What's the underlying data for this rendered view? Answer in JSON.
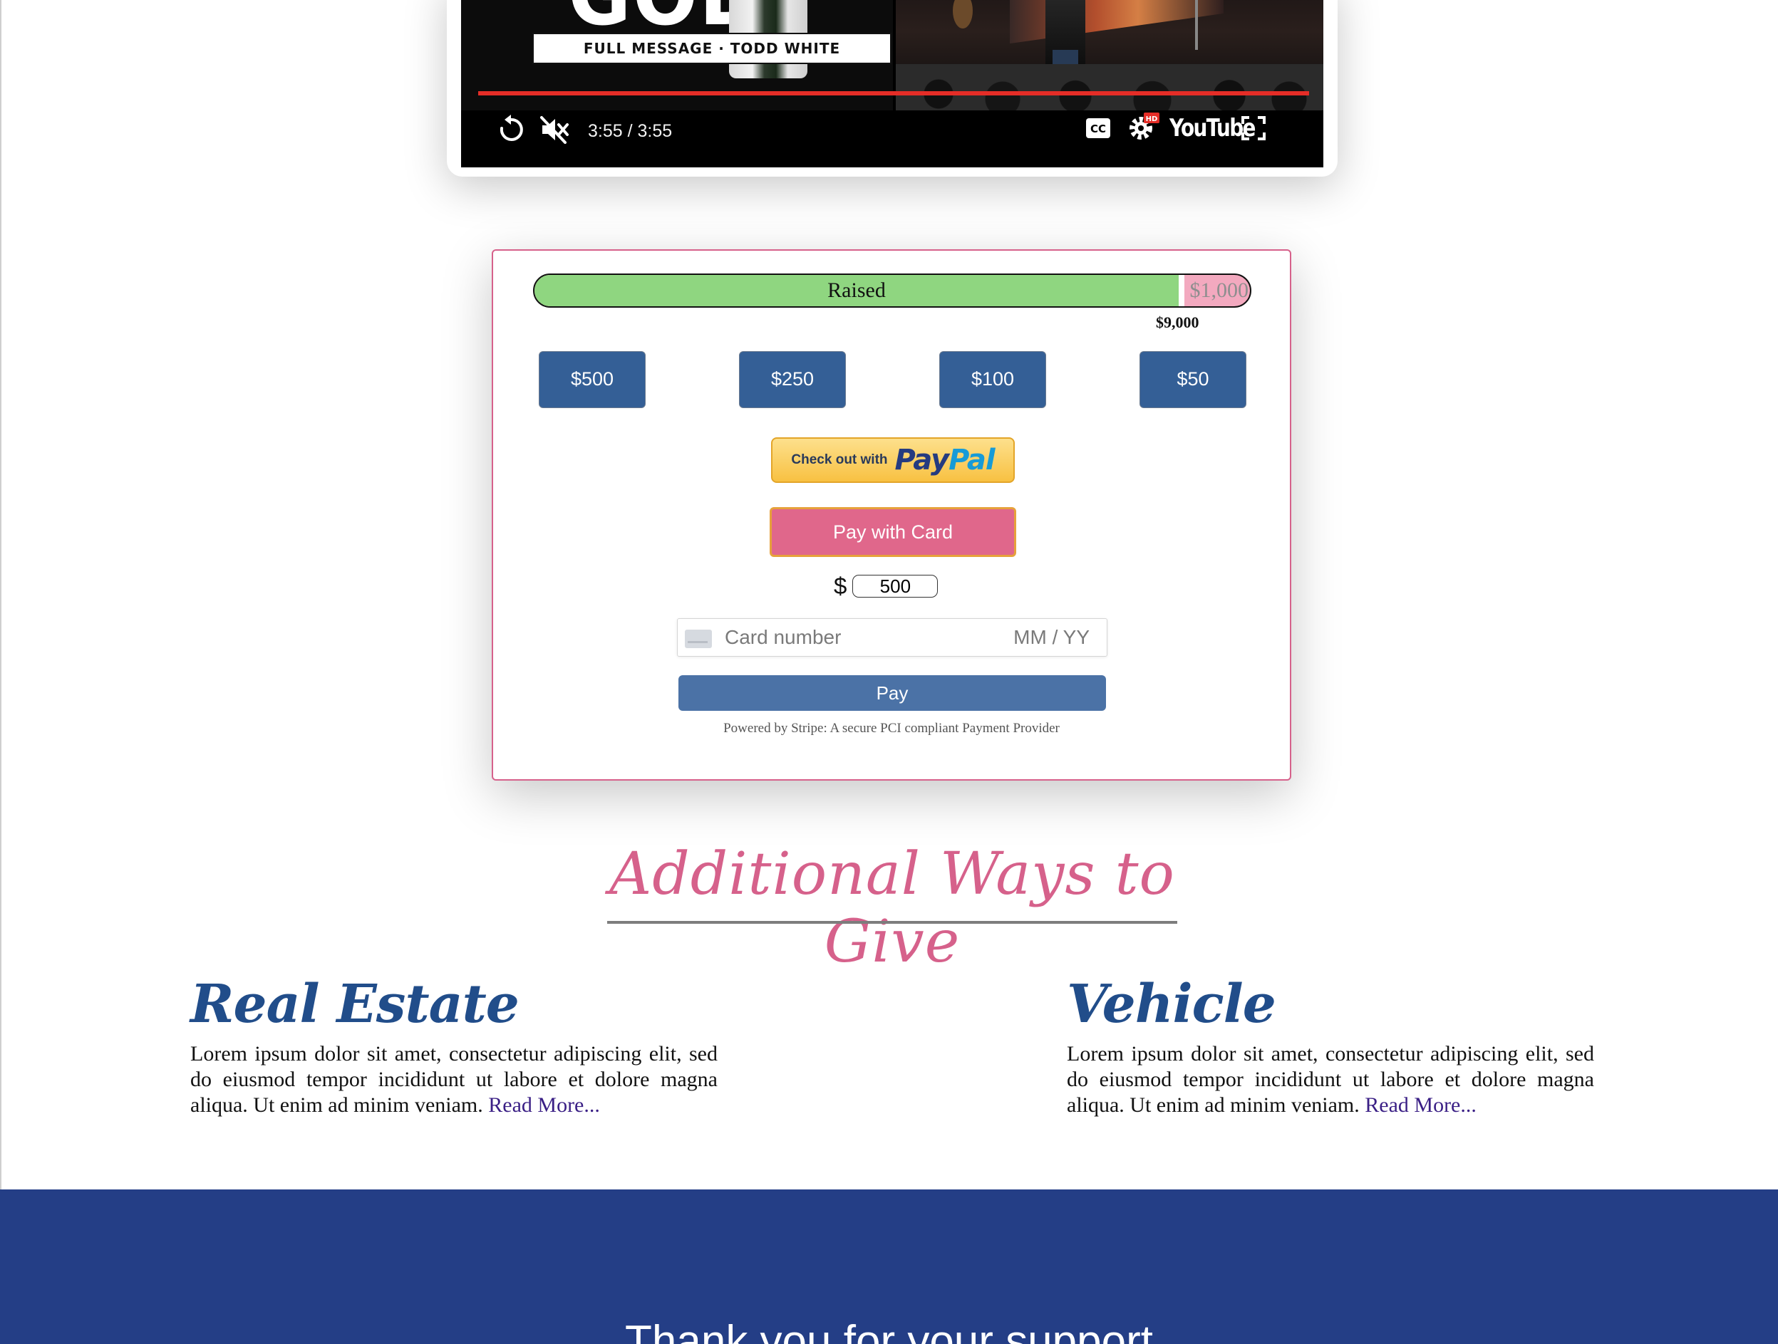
{
  "video": {
    "headline": "GOD",
    "subtitle": "FULL MESSAGE · TODD WHITE",
    "time_display": "3:55 / 3:55",
    "cc_label": "CC",
    "hd_badge": "HD",
    "platform_logo": "YouTube",
    "icons": [
      "replay-icon",
      "muted-icon",
      "captions-icon",
      "settings-icon",
      "fullscreen-icon"
    ],
    "progress_played_fraction": 1.0,
    "progress_color": "#e52d27"
  },
  "donation": {
    "raised_label": "Raised",
    "raised_amount": "$9,000",
    "remaining_amount": "$1,000",
    "raised_fraction": 0.9,
    "colors": {
      "raised": "#8fd680",
      "remaining": "#f3a9bf",
      "border": "#d6618b"
    },
    "amount_buttons": [
      "$500",
      "$250",
      "$100",
      "$50"
    ],
    "paypal": {
      "prefix": "Check out with",
      "brand_a": "Pay",
      "brand_b": "Pal"
    },
    "card_button": "Pay with Card",
    "currency_symbol": "$",
    "amount_value": "500",
    "card_number_placeholder": "Card number",
    "expiry_placeholder": "MM / YY",
    "pay_button": "Pay",
    "stripe_note": "Powered by Stripe: A secure PCI compliant Payment Provider"
  },
  "additional": {
    "title": "Additional Ways to Give",
    "items": [
      {
        "heading": "Real Estate",
        "body": "Lorem ipsum dolor sit amet, consectetur adipiscing elit, sed do eiusmod tempor incididunt ut labore et dolore magna aliqua. Ut enim ad minim veniam.",
        "link": "Read More..."
      },
      {
        "heading": "Vehicle",
        "body": "Lorem ipsum dolor sit amet, consectetur adipiscing elit, sed do eiusmod tempor incididunt ut labore et dolore magna aliqua. Ut enim ad minim veniam.",
        "link": "Read More..."
      }
    ]
  },
  "footer": {
    "text": "Thank you for your support"
  }
}
